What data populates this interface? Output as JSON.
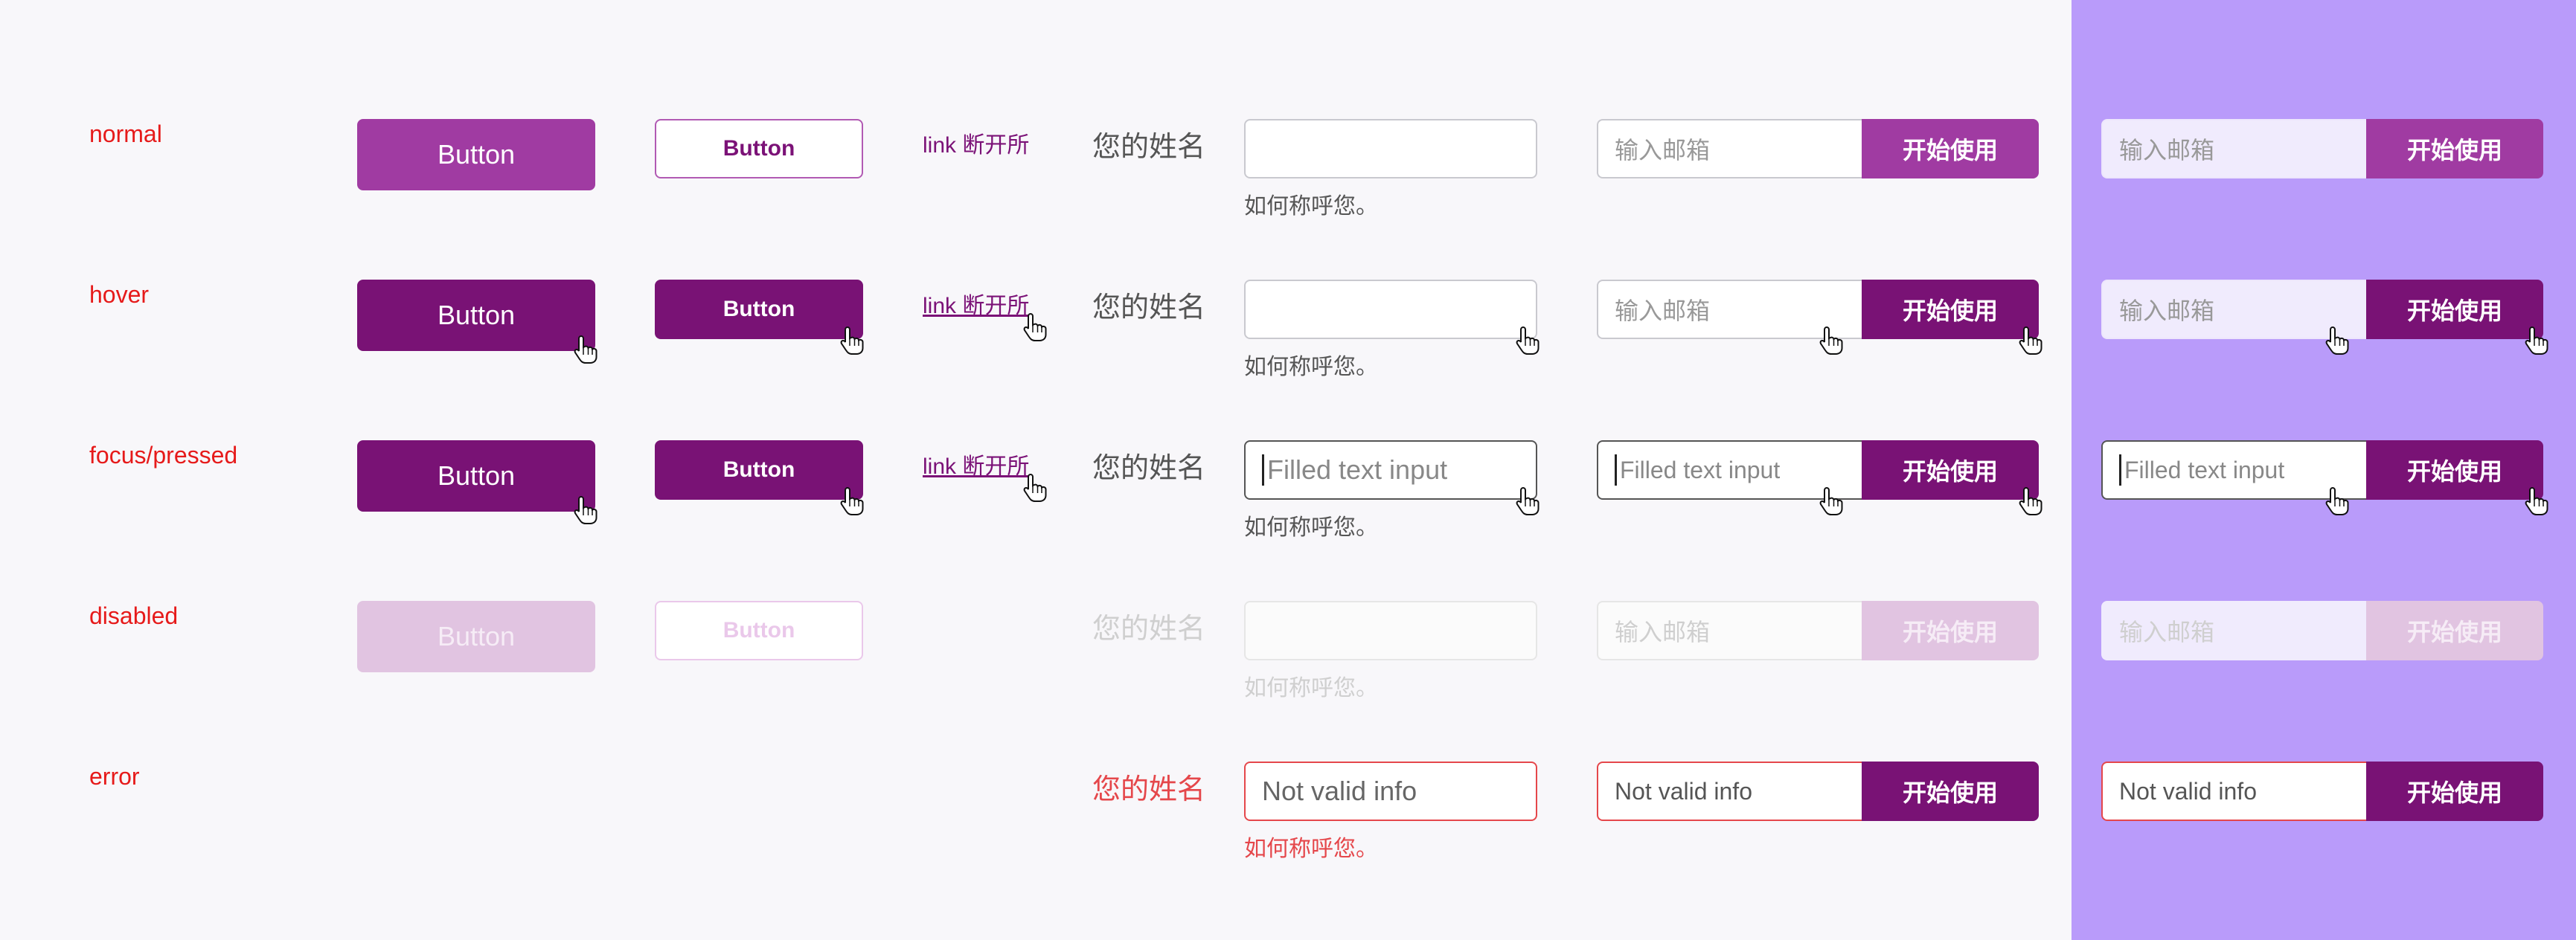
{
  "colors": {
    "background": "#f8f7fa",
    "purple_panel": "#b99bfa",
    "primary": "#a03ba2",
    "primary_dark": "#791275",
    "disabled": "#e1c4e1",
    "error": "#e5474b",
    "state_label": "#e61a1a"
  },
  "icons": {
    "hover_cursor": "hand-pointer-icon"
  },
  "rows": {
    "normal": {
      "state": "normal",
      "button_lg": "Button",
      "button_md": "Button",
      "link": "link 断开所",
      "field_label": "您的姓名",
      "input_value": "",
      "helper": "如何称呼您。",
      "combo1_input": "输入邮箱",
      "combo1_button": "开始使用",
      "combo2_input": "输入邮箱",
      "combo2_button": "开始使用"
    },
    "hover": {
      "state": "hover",
      "button_lg": "Button",
      "button_md": "Button",
      "link": "link 断开所",
      "field_label": "您的姓名",
      "input_value": "",
      "helper": "如何称呼您。",
      "combo1_input": "输入邮箱",
      "combo1_button": "开始使用",
      "combo2_input": "输入邮箱",
      "combo2_button": "开始使用"
    },
    "focus": {
      "state": "focus/pressed",
      "button_lg": "Button",
      "button_md": "Button",
      "link": "link 断开所",
      "field_label": "您的姓名",
      "input_value": "Filled text input",
      "helper": "如何称呼您。",
      "combo1_input": "Filled text input",
      "combo1_button": "开始使用",
      "combo2_input": "Filled text input",
      "combo2_button": "开始使用"
    },
    "disabled": {
      "state": "disabled",
      "button_lg": "Button",
      "button_md": "Button",
      "field_label": "您的姓名",
      "input_value": "",
      "helper": "如何称呼您。",
      "combo1_input": "输入邮箱",
      "combo1_button": "开始使用",
      "combo2_input": "输入邮箱",
      "combo2_button": "开始使用"
    },
    "error": {
      "state": "error",
      "field_label": "您的姓名",
      "input_value": "Not valid info",
      "helper": "如何称呼您。",
      "combo1_input": "Not valid info",
      "combo1_button": "开始使用",
      "combo2_input": "Not valid info",
      "combo2_button": "开始使用"
    }
  }
}
